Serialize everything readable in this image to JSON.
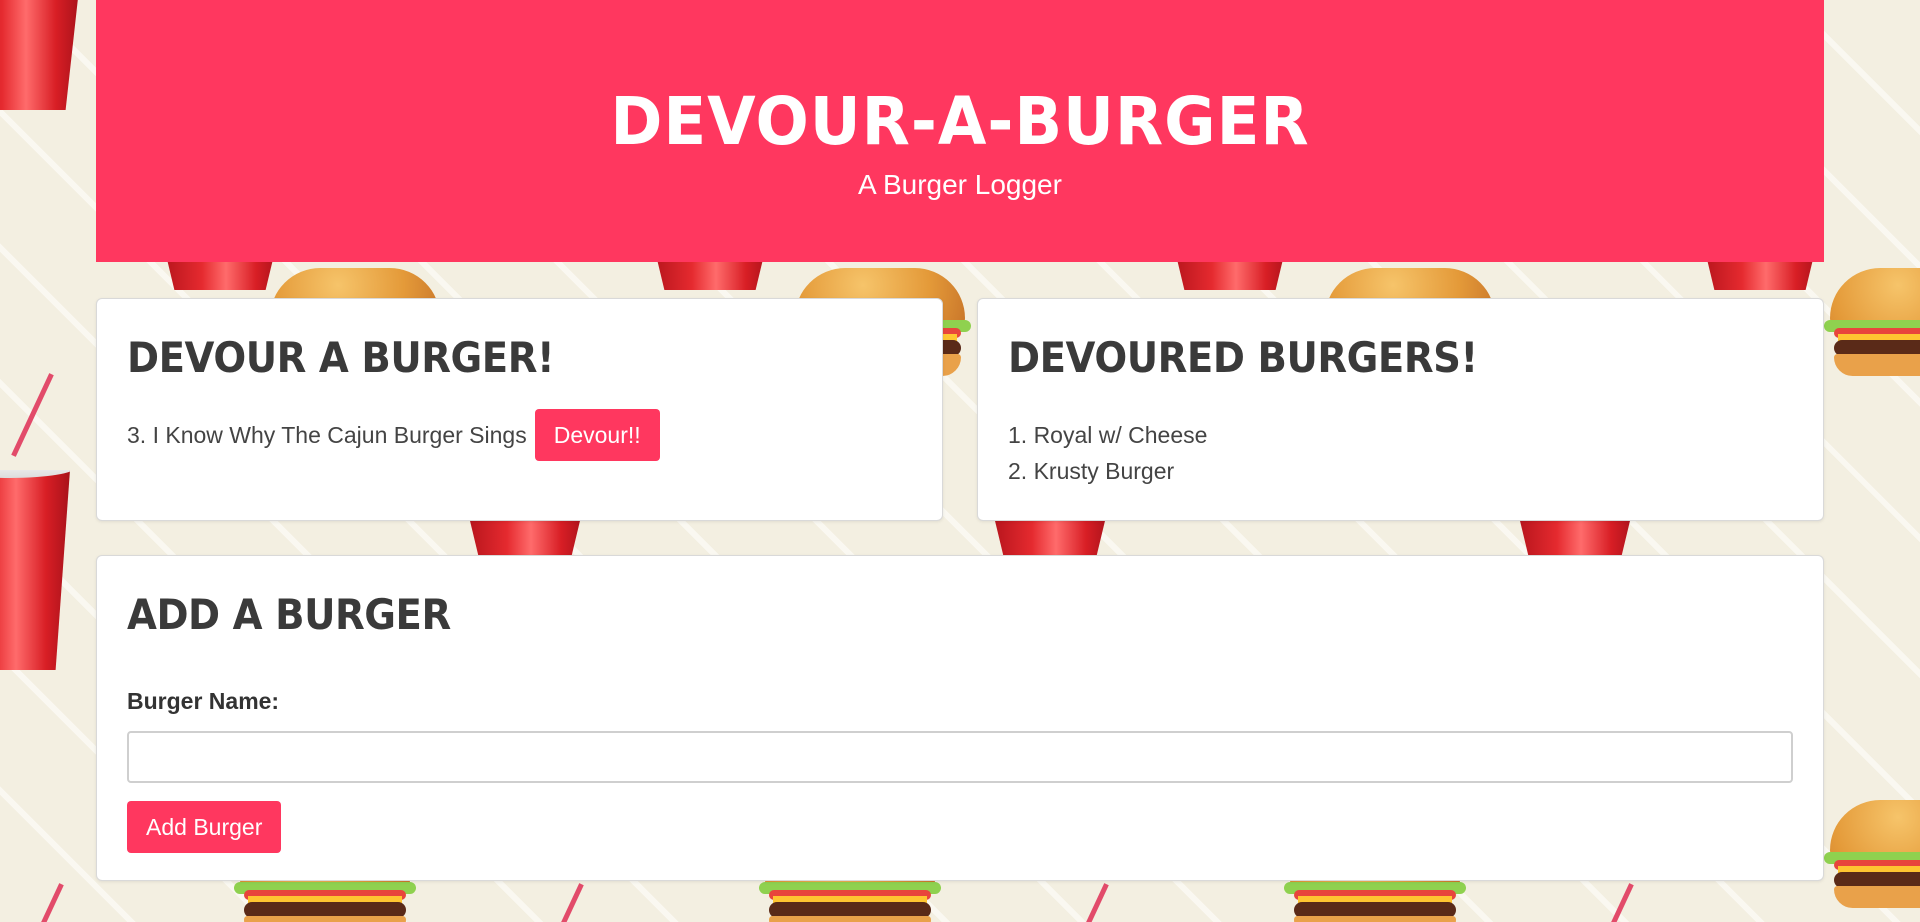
{
  "header": {
    "title": "Devour-A-Burger",
    "subtitle": "A Burger Logger"
  },
  "devour_panel": {
    "title": "Devour a Burger!",
    "items": [
      {
        "label": "3. I Know Why The Cajun Burger Sings",
        "button_label": "Devour!!"
      }
    ]
  },
  "devoured_panel": {
    "title": "Devoured Burgers!",
    "items": [
      {
        "label": "1. Royal w/ Cheese"
      },
      {
        "label": "2. Krusty Burger"
      }
    ]
  },
  "add_panel": {
    "title": "Add a Burger",
    "field_label": "Burger Name:",
    "field_value": "",
    "button_label": "Add Burger"
  },
  "colors": {
    "accent": "#ff375f",
    "background": "#f3efe1",
    "card": "#ffffff"
  },
  "icons": [
    "soda-cup-icon",
    "burger-icon",
    "straw-icon"
  ]
}
